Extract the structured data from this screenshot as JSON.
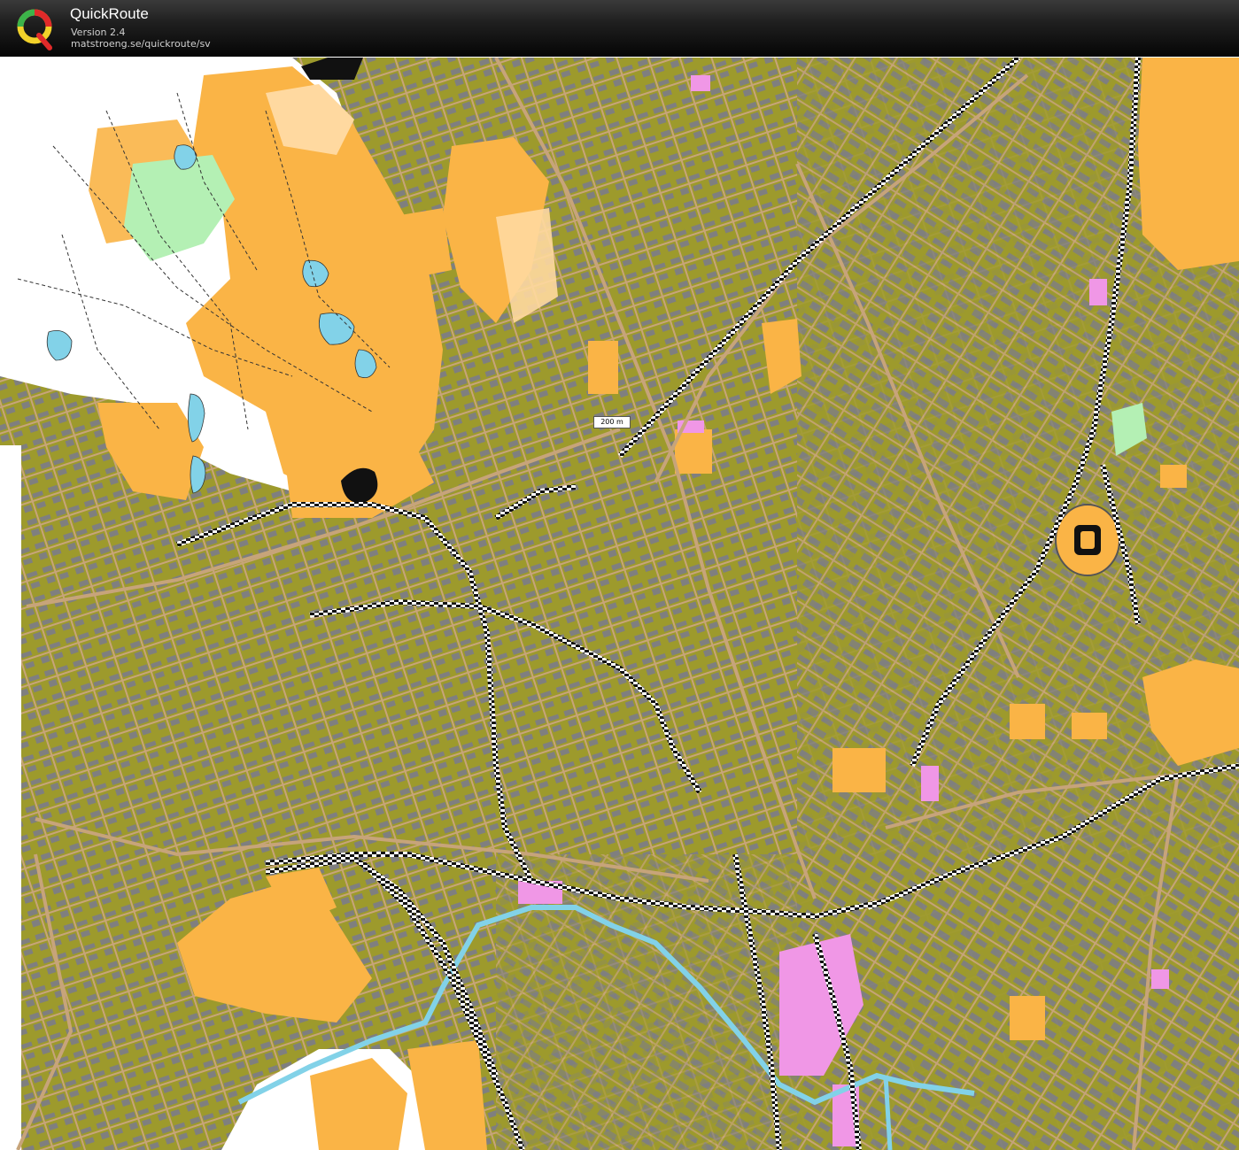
{
  "app": {
    "title": "QuickRoute",
    "version": "Version 2.4",
    "url": "matstroeng.se/quickroute/sv"
  },
  "icons": {
    "logo": "quickroute-q-logo"
  },
  "map": {
    "scale_label": "200 m"
  },
  "colors": {
    "urban_olive": "#9d9a2c",
    "open_orange": "#fab446",
    "light_open": "#ffd9a0",
    "building_gray": "#7f7f7f",
    "road_fill": "#c7a47a",
    "water_blue": "#82d2e8",
    "forest_green": "#b4f0b4",
    "magenta": "#f097e6",
    "railway_black": "#111111"
  }
}
